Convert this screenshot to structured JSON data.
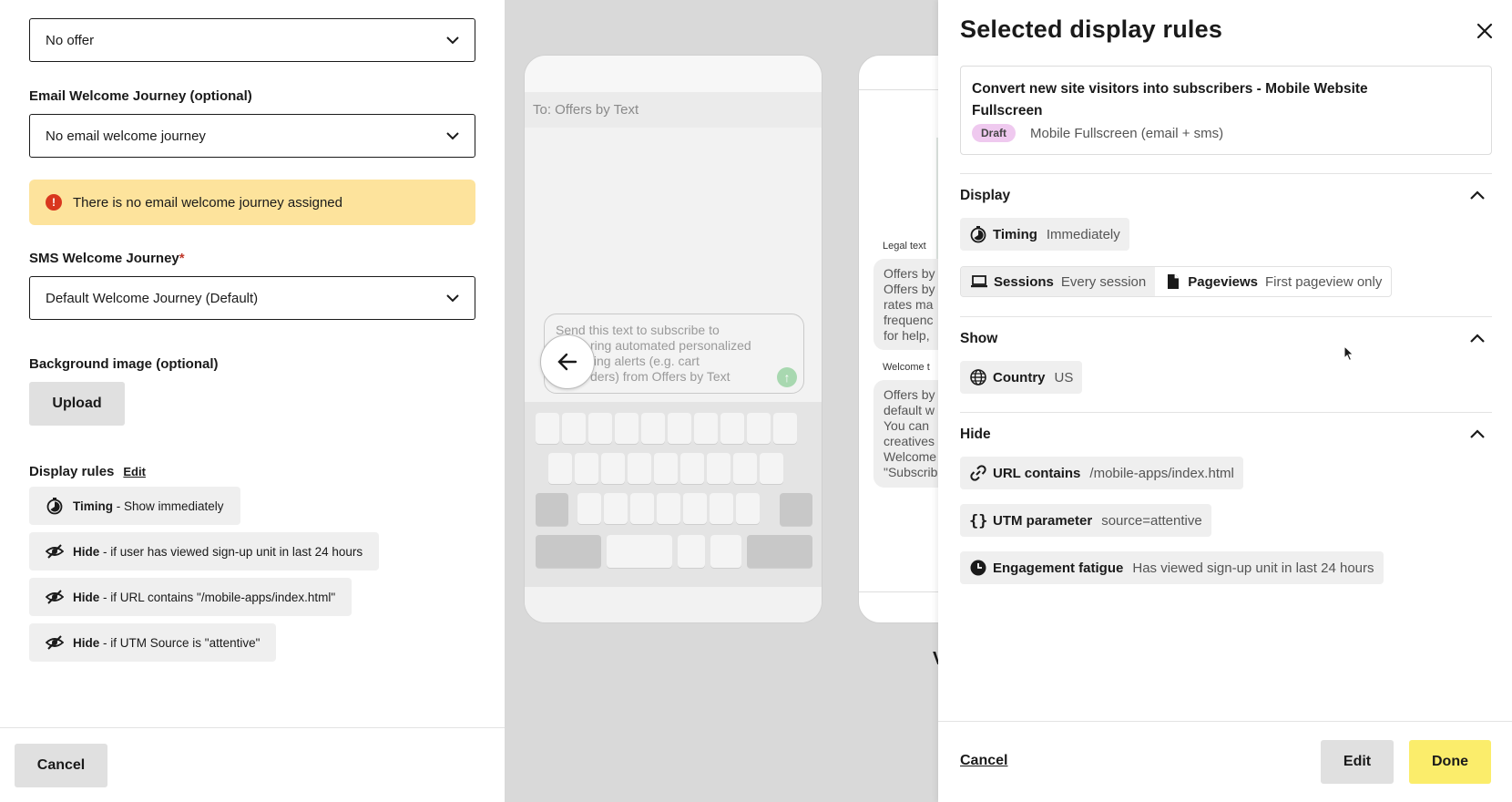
{
  "form": {
    "offer_select": "No offer",
    "email_journey_label": "Email Welcome Journey (optional)",
    "email_journey_select": "No email welcome journey",
    "warning_text": "There is no email welcome journey assigned",
    "sms_journey_label": "SMS Welcome Journey",
    "sms_required_marker": "*",
    "sms_journey_select": "Default Welcome Journey (Default)",
    "background_label": "Background image (optional)",
    "upload_label": "Upload",
    "display_rules_label": "Display rules",
    "display_rules_edit": "Edit",
    "rules": [
      {
        "kind": "Timing",
        "text": " - Show immediately"
      },
      {
        "kind": "Hide",
        "text": " - if user has viewed sign-up unit in last 24 hours"
      },
      {
        "kind": "Hide",
        "text": " - if URL contains \"/mobile-apps/index.html\""
      },
      {
        "kind": "Hide",
        "text": " - if UTM Source is \"attentive\""
      }
    ],
    "cancel_label": "Cancel"
  },
  "preview": {
    "to_line": "To: Offers by Text",
    "message_lines": [
      "Send this text to subscribe to",
      "ring automated personalized",
      "ting alerts (e.g. cart",
      "ders) from Offers by Text"
    ],
    "legal_label": "Legal text",
    "legal_lines": [
      "Offers by",
      "Offers by",
      "rates ma",
      "frequenc",
      "for help,"
    ],
    "welcome_label": "Welcome t",
    "welcome_lines": [
      "Offers by",
      "default w",
      "You can",
      "creatives",
      "Welcome",
      "\"Subscrib"
    ],
    "bottom_letter": "V"
  },
  "panel": {
    "title": "Selected display rules",
    "card_title": "Convert new site visitors into subscribers - Mobile Website Fullscreen",
    "card_badge": "Draft",
    "card_subtitle": "Mobile Fullscreen (email + sms)",
    "display_header": "Display",
    "timing_label": "Timing",
    "timing_value": "Immediately",
    "sessions_label": "Sessions",
    "sessions_value": "Every session",
    "pageviews_label": "Pageviews",
    "pageviews_value": "First pageview only",
    "show_header": "Show",
    "country_label": "Country",
    "country_value": "US",
    "hide_header": "Hide",
    "url_label": "URL contains",
    "url_value": "/mobile-apps/index.html",
    "utm_label": "UTM parameter",
    "utm_value": "source=attentive",
    "fatigue_label": "Engagement fatigue",
    "fatigue_value": "Has viewed sign-up unit in last 24 hours",
    "cancel_label": "Cancel",
    "edit_label": "Edit",
    "done_label": "Done"
  }
}
